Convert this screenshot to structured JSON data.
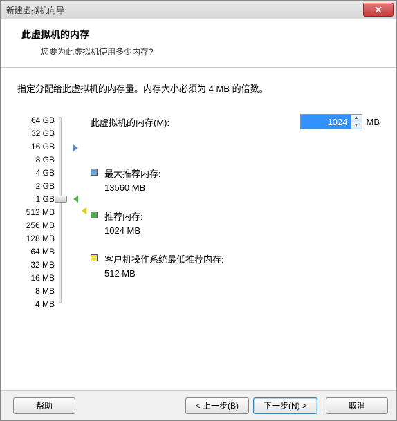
{
  "window": {
    "title": "新建虚拟机向导"
  },
  "header": {
    "title": "此虚拟机的内存",
    "subtitle": "您要为此虚拟机使用多少内存?"
  },
  "instruction": "指定分配给此虚拟机的内存量。内存大小必须为 4 MB 的倍数。",
  "memory": {
    "field_label": "此虚拟机的内存(M):",
    "value": "1024",
    "unit": "MB"
  },
  "scale": {
    "ticks": [
      "64 GB",
      "32 GB",
      "16 GB",
      "8 GB",
      "4 GB",
      "2 GB",
      "1 GB",
      "512 MB",
      "256 MB",
      "128 MB",
      "64 MB",
      "32 MB",
      "16 MB",
      "8 MB",
      "4 MB"
    ]
  },
  "markers": {
    "max": {
      "label": "最大推荐内存:",
      "value": "13560 MB",
      "color": "#6ea0d8"
    },
    "rec": {
      "label": "推荐内存:",
      "value": "1024 MB",
      "color": "#4caa4c"
    },
    "min": {
      "label": "客户机操作系统最低推荐内存:",
      "value": "512 MB",
      "color": "#f4e24c"
    }
  },
  "buttons": {
    "help": "帮助",
    "back": "< 上一步(B)",
    "next": "下一步(N) >",
    "cancel": "取消"
  }
}
